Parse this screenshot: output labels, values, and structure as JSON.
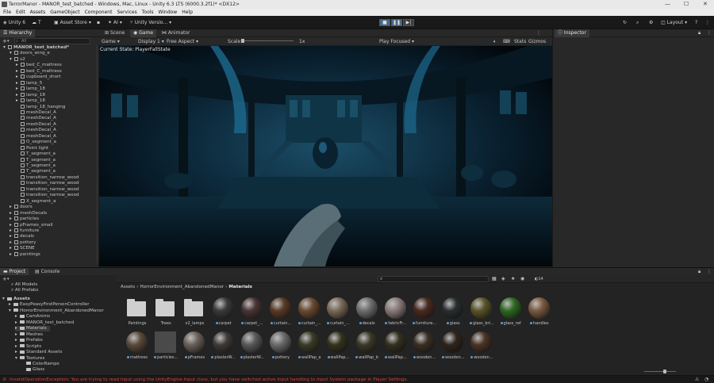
{
  "window": {
    "title": "TerrorManor - MANOR_test_batched - Windows, Mac, Linux - Unity 6.3 LTS (6000.3.2f1)* <DX12>"
  },
  "menu": [
    "File",
    "Edit",
    "Assets",
    "GameObject",
    "Component",
    "Services",
    "Tools",
    "Window",
    "Help"
  ],
  "toolbar": {
    "account": "Unity 6",
    "cloud": "T",
    "asset_store": "Asset Store",
    "ai": "AI",
    "version_control": "Unity Versio...",
    "layout": "Layout"
  },
  "hierarchy": {
    "tab": "Hierarchy",
    "search_placeholder": "All",
    "items": [
      "MANOR_test_batched*",
      "doors_wing_e",
      "v2",
      "bed_C_mattress",
      "bed_C_mattress",
      "cupboard_short",
      "lamp_5",
      "lamp_18",
      "lamp_18",
      "lamp_18",
      "lamp_18_hanging",
      "meshDecal_A",
      "meshDecal_A",
      "meshDecal_A",
      "meshDecal_A",
      "meshDecal_A",
      "O_segment_a",
      "Point light",
      "T_segment_a",
      "T_segment_a",
      "T_segment_a",
      "T_segment_a",
      "transition_narrow_wood",
      "transition_narrow_wood",
      "transition_narrow_wood",
      "transition_narrow_wood",
      "X_segment_a",
      "doors",
      "meshDecals",
      "particles",
      "pFrames_small",
      "furniture",
      "decals",
      "pottery",
      "SCENE",
      "paintings"
    ]
  },
  "scene_tabs": {
    "scene": "Scene",
    "game": "Game",
    "animator": "Animator"
  },
  "game_bar": {
    "mode": "Game",
    "display": "Display 1",
    "aspect": "Free Aspect",
    "scale_label": "Scale",
    "scale_value": "1x",
    "play_mode": "Play Focused",
    "stats": "Stats",
    "gizmos": "Gizmos"
  },
  "game_overlay": {
    "state_text": "Current State: PlayerFallState"
  },
  "inspector": {
    "tab": "Inspector"
  },
  "project": {
    "tab_project": "Project",
    "tab_console": "Console",
    "favorites": [
      "All Models",
      "All Prefabs"
    ],
    "tree": [
      {
        "label": "Assets",
        "depth": 0
      },
      {
        "label": "EasyPeasyFirstPersonController",
        "depth": 1
      },
      {
        "label": "HorrorEnvironment_AbandonedManor",
        "depth": 1
      },
      {
        "label": "CamAnims",
        "depth": 2
      },
      {
        "label": "MANOR_test_batched",
        "depth": 2
      },
      {
        "label": "Materials",
        "depth": 2
      },
      {
        "label": "Meshes",
        "depth": 2
      },
      {
        "label": "Prefabs",
        "depth": 2
      },
      {
        "label": "Scripts",
        "depth": 2
      },
      {
        "label": "Standard Assets",
        "depth": 2
      },
      {
        "label": "Textures",
        "depth": 2
      },
      {
        "label": "ColorRamps",
        "depth": 3
      },
      {
        "label": "Glass",
        "depth": 3
      }
    ],
    "breadcrumb": [
      "Assets",
      "HorrorEnvironment_AbandonedManor",
      "Materials"
    ],
    "item_count": "14",
    "row1": [
      {
        "label": "Paintings",
        "kind": "folder"
      },
      {
        "label": "Trees",
        "kind": "folder"
      },
      {
        "label": "v2_lamps",
        "kind": "folder"
      },
      {
        "label": "carpet",
        "kind": "mat",
        "color": "#3a3a3a"
      },
      {
        "label": "carpet_...",
        "kind": "mat",
        "color": "#4a3434"
      },
      {
        "label": "curtain...",
        "kind": "mat",
        "color": "#5a3a26"
      },
      {
        "label": "curtain_...",
        "kind": "mat",
        "color": "#6b4a30"
      },
      {
        "label": "curtain_...",
        "kind": "mat",
        "color": "#7a6a58"
      },
      {
        "label": "decals",
        "kind": "mat",
        "color": "#6e6e6e"
      },
      {
        "label": "fabricFr...",
        "kind": "mat",
        "color": "#8a7a7a"
      },
      {
        "label": "furniture...",
        "kind": "mat",
        "color": "#4a2a20"
      },
      {
        "label": "glass",
        "kind": "mat",
        "color": "#2a2e30"
      },
      {
        "label": "glass_bri...",
        "kind": "mat",
        "color": "#5a5428"
      },
      {
        "label": "glass_ref",
        "kind": "mat",
        "color": "#2e6a22"
      },
      {
        "label": "handles",
        "kind": "mat",
        "color": "#7a5a40"
      }
    ],
    "row2": [
      {
        "label": "mattress",
        "kind": "mat",
        "color": "#5a4a3a"
      },
      {
        "label": "particles...",
        "kind": "sq",
        "color": "#4a4a4a"
      },
      {
        "label": "pFrames",
        "kind": "mat",
        "color": "#6a6058"
      },
      {
        "label": "plasterW...",
        "kind": "mat",
        "color": "#3e3a36"
      },
      {
        "label": "plasterW...",
        "kind": "mat",
        "color": "#585858"
      },
      {
        "label": "pottery",
        "kind": "mat",
        "color": "#6a6a6a"
      },
      {
        "label": "wallPap_a",
        "kind": "mat",
        "color": "#3a3a26"
      },
      {
        "label": "wallPap...",
        "kind": "mat",
        "color": "#34321e"
      },
      {
        "label": "wallPap_b",
        "kind": "mat",
        "color": "#3a3826"
      },
      {
        "label": "wallPap...",
        "kind": "mat",
        "color": "#33301e"
      },
      {
        "label": "wooden...",
        "kind": "mat",
        "color": "#3a2e24"
      },
      {
        "label": "wooden...",
        "kind": "mat",
        "color": "#2e241c"
      },
      {
        "label": "wooden...",
        "kind": "mat",
        "color": "#4a3424"
      }
    ]
  },
  "status": {
    "error": "InvalidOperationException: You are trying to read Input using the UnityEngine.Input class, but you have switched active Input handling to Input System package in Player Settings."
  }
}
